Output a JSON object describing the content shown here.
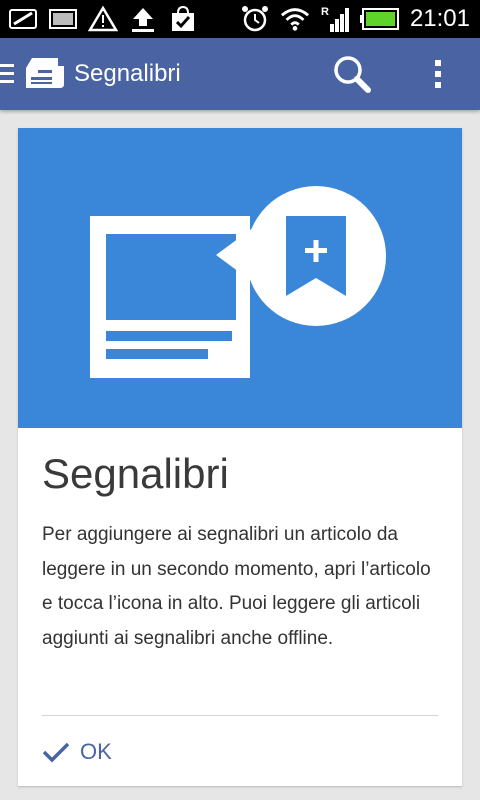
{
  "status_bar": {
    "time": "21:01",
    "icons": [
      "notification-icon",
      "image-icon",
      "warning-icon",
      "upload-icon",
      "store-icon",
      "alarm-icon",
      "wifi-icon",
      "signal-icon",
      "battery-icon"
    ]
  },
  "appbar": {
    "title": "Segnalibri",
    "color": "#4a64a3",
    "actions": [
      "search-icon",
      "overflow-menu-icon"
    ]
  },
  "card": {
    "hero_color": "#3a87d9",
    "title": "Segnalibri",
    "body": "Per aggiungere ai segnalibri un articolo da leggere in un secondo momento, apri l’articolo e tocca l’icona in alto. Puoi leggere gli articoli aggiunti ai segnalibri anche offline.",
    "ok_label": "OK"
  }
}
